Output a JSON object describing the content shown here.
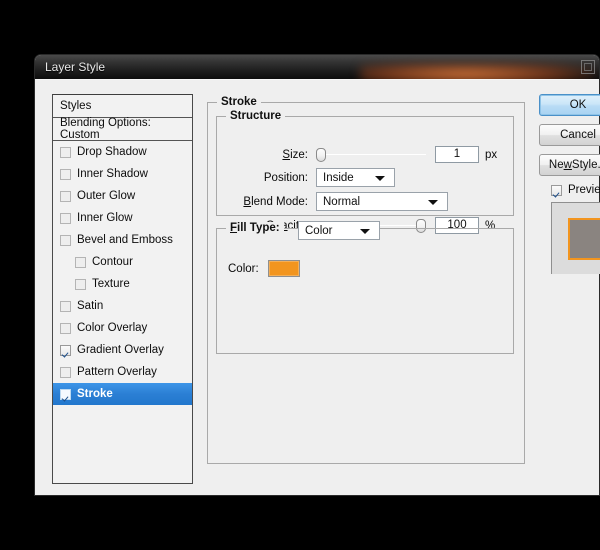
{
  "window": {
    "title": "Layer Style",
    "maximize_icon": "restore-icon"
  },
  "styles_list": {
    "header_styles": "Styles",
    "header_blending": "Blending Options: Custom",
    "items": [
      {
        "label": "Drop Shadow",
        "checked": false,
        "indent": false,
        "selected": false
      },
      {
        "label": "Inner Shadow",
        "checked": false,
        "indent": false,
        "selected": false
      },
      {
        "label": "Outer Glow",
        "checked": false,
        "indent": false,
        "selected": false
      },
      {
        "label": "Inner Glow",
        "checked": false,
        "indent": false,
        "selected": false
      },
      {
        "label": "Bevel and Emboss",
        "checked": false,
        "indent": false,
        "selected": false
      },
      {
        "label": "Contour",
        "checked": false,
        "indent": true,
        "selected": false
      },
      {
        "label": "Texture",
        "checked": false,
        "indent": true,
        "selected": false
      },
      {
        "label": "Satin",
        "checked": false,
        "indent": false,
        "selected": false
      },
      {
        "label": "Color Overlay",
        "checked": false,
        "indent": false,
        "selected": false
      },
      {
        "label": "Gradient Overlay",
        "checked": true,
        "indent": false,
        "selected": false
      },
      {
        "label": "Pattern Overlay",
        "checked": false,
        "indent": false,
        "selected": false
      },
      {
        "label": "Stroke",
        "checked": true,
        "indent": false,
        "selected": true
      }
    ]
  },
  "panel": {
    "group_title": "Stroke",
    "structure": {
      "title": "Structure",
      "size_label": "Size:",
      "size_value": "1",
      "size_unit": "px",
      "size_slider_percent": 0,
      "position_label": "Position:",
      "position_value": "Inside",
      "blend_mode_label": "Blend Mode:",
      "blend_mode_value": "Normal",
      "opacity_label": "Opacity:",
      "opacity_value": "100",
      "opacity_unit": "%",
      "opacity_slider_percent": 100
    },
    "fill": {
      "title": "Fill Type:",
      "fill_type_value": "Color",
      "color_label": "Color:",
      "color_hex": "#f2951f"
    }
  },
  "buttons": {
    "ok": "OK",
    "cancel": "Cancel",
    "new_style": "New Style...",
    "preview_label": "Preview",
    "preview_checked": true
  },
  "preview": {
    "fill_hex": "#8a8480",
    "stroke_hex": "#f2951f"
  },
  "colors": {
    "accent_selection": "#2b7fd4",
    "dialog_bg": "#efefef",
    "titlebar_dark": "#1a1a1a",
    "backdrop": "#000000",
    "orange": "#f2951f"
  }
}
